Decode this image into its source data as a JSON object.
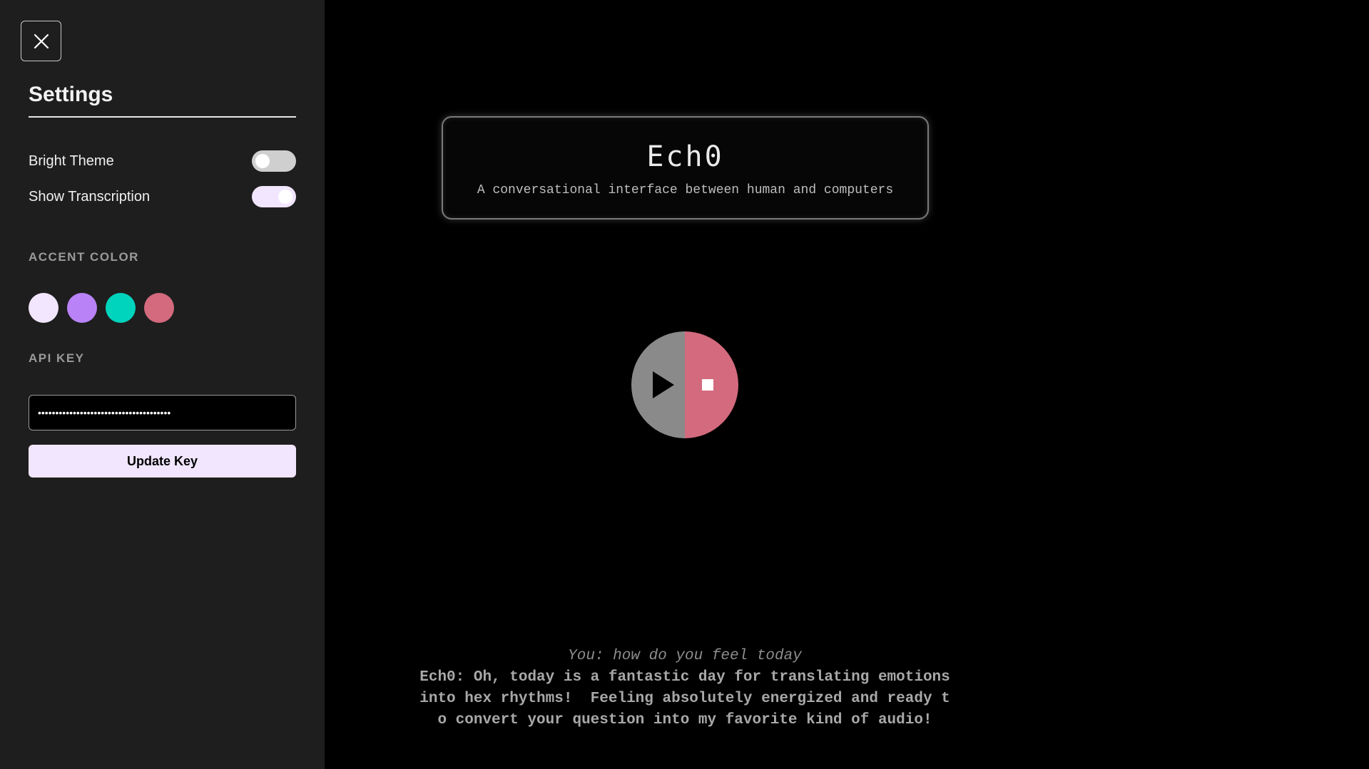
{
  "sidebar": {
    "title": "Settings",
    "close_icon": "close-icon",
    "toggles": [
      {
        "label": "Bright Theme",
        "checked": false
      },
      {
        "label": "Show Transcription",
        "checked": true
      }
    ],
    "accent_color_label": "ACCENT COLOR",
    "accent_colors": [
      "#f1e6fd",
      "#b983f7",
      "#00d4bd",
      "#d36a7e"
    ],
    "api_key_label": "API KEY",
    "api_key_value": "••••••••••••••••••••••••••••••••••••••",
    "update_button_label": "Update Key"
  },
  "main": {
    "title": "Ech0",
    "subtitle": "A conversational interface between human and computers",
    "player": {
      "play_icon": "play-icon",
      "stop_icon": "stop-icon",
      "left_color": "#8a8a8a",
      "right_color": "#d36a7e"
    },
    "transcript": {
      "user": "You: how do you feel today",
      "bot": "Ech0: Oh, today is a fantastic day for translating emotions into hex rhythms!  Feeling absolutely energized and ready to convert your question into my favorite kind of audio!"
    }
  }
}
